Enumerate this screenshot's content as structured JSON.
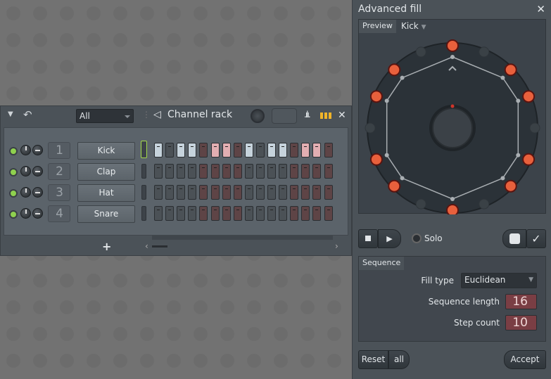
{
  "channel_rack": {
    "title": "Channel rack",
    "filter": "All",
    "channels": [
      {
        "number": "1",
        "name": "Kick",
        "selected": true,
        "steps": [
          1,
          0,
          1,
          1,
          0,
          1,
          1,
          0,
          1,
          0,
          1,
          1,
          0,
          1,
          1,
          0
        ]
      },
      {
        "number": "2",
        "name": "Clap",
        "selected": false,
        "steps": [
          0,
          0,
          0,
          0,
          0,
          0,
          0,
          0,
          0,
          0,
          0,
          0,
          0,
          0,
          0,
          0
        ]
      },
      {
        "number": "3",
        "name": "Hat",
        "selected": false,
        "steps": [
          0,
          0,
          0,
          0,
          0,
          0,
          0,
          0,
          0,
          0,
          0,
          0,
          0,
          0,
          0,
          0
        ]
      },
      {
        "number": "4",
        "name": "Snare",
        "selected": false,
        "steps": [
          0,
          0,
          0,
          0,
          0,
          0,
          0,
          0,
          0,
          0,
          0,
          0,
          0,
          0,
          0,
          0
        ]
      }
    ],
    "add_label": "+",
    "icons": [
      "menu-arrow-icon",
      "undo-icon",
      "speaker-icon",
      "graph-icon",
      "piano-roll-icon",
      "close-icon"
    ]
  },
  "advanced_fill": {
    "title": "Advanced fill",
    "close": "✕",
    "preview_tab": "Preview",
    "preview_channel": "Kick",
    "steps": [
      1,
      0,
      1,
      1,
      0,
      1,
      1,
      0,
      1,
      0,
      1,
      1,
      0,
      1,
      1,
      0
    ],
    "solo_label": "Solo",
    "sequence_tab": "Sequence",
    "fill_type_label": "Fill type",
    "fill_type": "Euclidean",
    "sequence_length_label": "Sequence length",
    "sequence_length": "16",
    "step_count_label": "Step count",
    "step_count": "10",
    "reset_label": "Reset",
    "all_label": "all",
    "accept_label": "Accept",
    "colors": {
      "active_step": "#e8603c",
      "accent_green": "#8fd14f"
    }
  }
}
